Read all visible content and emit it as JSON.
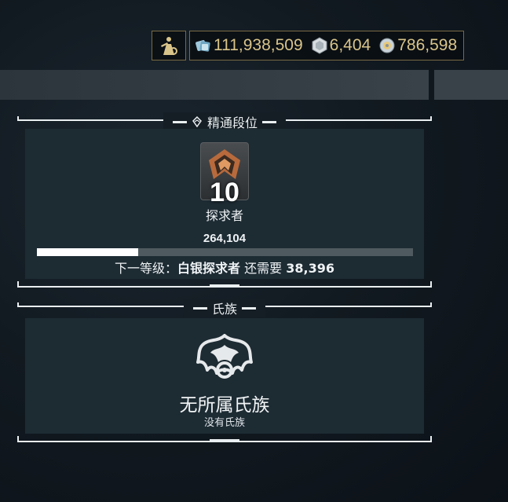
{
  "currency": {
    "credits": "111,938,509",
    "platinum": "6,404",
    "endo": "786,598"
  },
  "mastery_section": {
    "title": "精通段位",
    "rank_number": "10",
    "rank_name": "探求者",
    "xp_current": "264,104",
    "xp_progress_fraction": 0.27,
    "next_prefix": "下一等级：",
    "next_rank": "白银探求者",
    "next_mid": " 还需要 ",
    "next_remaining": "38,396"
  },
  "clan_section": {
    "title": "氏族",
    "clan_name": "无所属氏族",
    "clan_sub": "没有氏族"
  },
  "colors": {
    "gold_text": "#d9c48a",
    "rank_badge_copper": "#c97a45",
    "panel_bg": "#1d2b33"
  },
  "icons": {
    "profile_button": "syndicate-figure-icon",
    "credits": "credits-icon",
    "platinum": "platinum-icon",
    "endo": "endo-icon",
    "mastery": "mastery-rank-icon",
    "clan": "clan-emblem-icon"
  }
}
